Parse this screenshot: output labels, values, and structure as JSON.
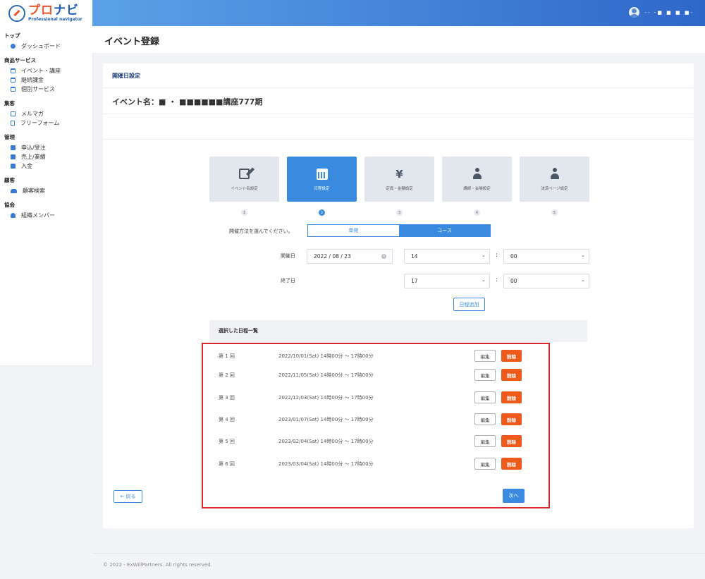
{
  "app": {
    "logo_title_a": "プロ",
    "logo_title_b": "ナビ",
    "logo_sub": "Professional navigator",
    "user_name": "-- -■ ■ ■ ■-"
  },
  "sidebar": {
    "sections": [
      {
        "head": "トップ",
        "items": [
          {
            "label": "ダッシュボード",
            "icon": "dashboard-icon"
          }
        ]
      },
      {
        "head": "商品サービス",
        "items": [
          {
            "label": "イベント・講座",
            "icon": "calendar-icon"
          },
          {
            "label": "継続課金",
            "icon": "calendar-icon"
          },
          {
            "label": "個別サービス",
            "icon": "calendar-icon"
          }
        ]
      },
      {
        "head": "集客",
        "items": [
          {
            "label": "メルマガ",
            "icon": "mail-icon"
          },
          {
            "label": "フリーフォーム",
            "icon": "document-icon"
          }
        ]
      },
      {
        "head": "管理",
        "items": [
          {
            "label": "申込/受注",
            "icon": "box-icon"
          },
          {
            "label": "売上/業績",
            "icon": "box-icon"
          },
          {
            "label": "入金",
            "icon": "box-icon"
          }
        ]
      },
      {
        "head": "顧客",
        "items": [
          {
            "label": "顧客検索",
            "icon": "users-icon"
          }
        ]
      },
      {
        "head": "協会",
        "items": [
          {
            "label": "組織メンバー",
            "icon": "user-icon"
          }
        ]
      }
    ]
  },
  "page": {
    "title": "イベント登録",
    "card_head": "開催日設定",
    "event_name": "イベント名：■ ・ ■■■■■■講座777期"
  },
  "steps": [
    {
      "label": "イベント名設定",
      "num": "1",
      "icon": "edit-icon",
      "glyph": ""
    },
    {
      "label": "日程設定",
      "num": "2",
      "icon": "calendar-icon",
      "glyph": "",
      "active": true
    },
    {
      "label": "定員・金額設定",
      "num": "3",
      "icon": "yen-icon",
      "glyph": "¥"
    },
    {
      "label": "講師・会場設定",
      "num": "4",
      "icon": "location-person-icon",
      "glyph": ""
    },
    {
      "label": "決済ページ設定",
      "num": "5",
      "icon": "stamp-icon",
      "glyph": ""
    }
  ],
  "method": {
    "label": "開催方法を選んでください。",
    "options": [
      "単発",
      "コース"
    ],
    "selected": "コース"
  },
  "start": {
    "label": "開催日",
    "date": "2022 / 08 / 23",
    "hour": "14",
    "minute": "00"
  },
  "end": {
    "label": "終了日",
    "hour": "17",
    "minute": "00"
  },
  "add_button": "日程追加",
  "schedule": {
    "head": "選択した日程一覧",
    "edit_label": "編集",
    "delete_label": "削除",
    "rows": [
      {
        "no": "第 1 回",
        "date": "2022/10/01(Sat) 14時00分 〜 17時00分"
      },
      {
        "no": "第 2 回",
        "date": "2022/11/05(Sat) 14時00分 〜 17時00分"
      },
      {
        "no": "第 3 回",
        "date": "2022/12/03(Sat) 14時00分 〜 17時00分"
      },
      {
        "no": "第 4 回",
        "date": "2023/01/07(Sat) 14時00分 〜 17時00分"
      },
      {
        "no": "第 5 回",
        "date": "2023/02/04(Sat) 14時00分 〜 17時00分"
      },
      {
        "no": "第 6 回",
        "date": "2023/03/04(Sat) 14時00分 〜 17時00分"
      }
    ]
  },
  "back_button": "← 戻る",
  "next_button": "次へ",
  "footer": "© 2022 - ExWillPartners. All rights reserved.",
  "colors": {
    "accent": "#3a8be0",
    "danger": "#ee5a1c",
    "highlight": "#d9272e"
  }
}
